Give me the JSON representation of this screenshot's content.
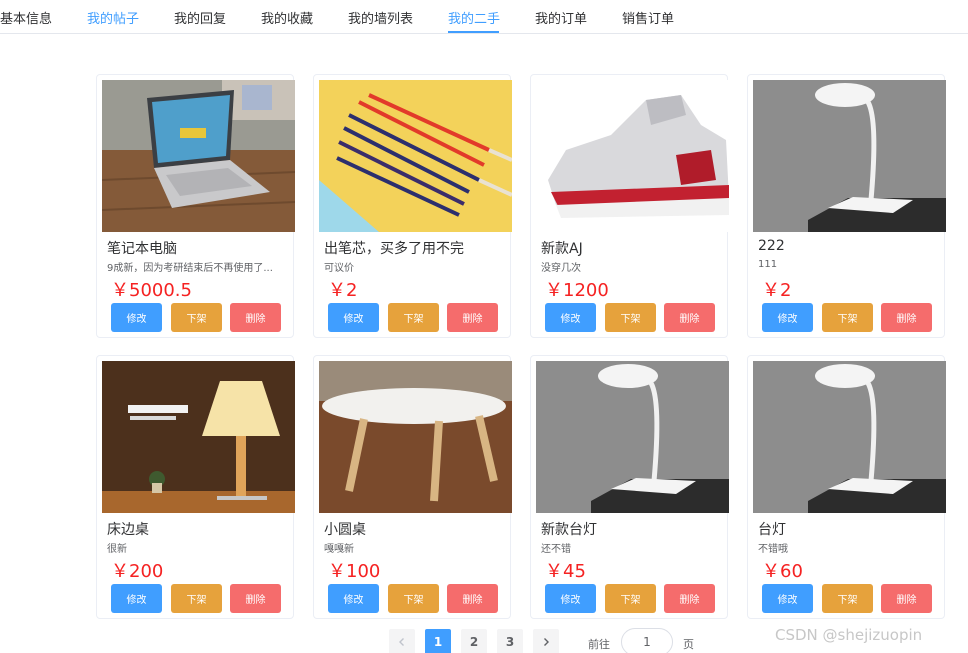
{
  "tabs": [
    {
      "label": "基本信息",
      "active": false
    },
    {
      "label": "我的帖子",
      "active": false
    },
    {
      "label": "我的回复",
      "active": false
    },
    {
      "label": "我的收藏",
      "active": false
    },
    {
      "label": "我的墙列表",
      "active": false
    },
    {
      "label": "我的二手",
      "active": true
    },
    {
      "label": "我的订单",
      "active": false
    },
    {
      "label": "销售订单",
      "active": false
    }
  ],
  "accent_color": "#409eff",
  "price_color": "#f52222",
  "button_labels": {
    "edit": "修改",
    "offline": "下架",
    "delete": "删除"
  },
  "products": [
    {
      "title": "笔记本电脑",
      "desc": "9成新，因为考研结束后不再使用了...",
      "price": "￥5000.5",
      "image": "laptop"
    },
    {
      "title": "出笔芯，买多了用不完",
      "desc": "可议价",
      "price": "￥2",
      "image": "pen-refills"
    },
    {
      "title": "新款AJ",
      "desc": "没穿几次",
      "price": "￥1200",
      "image": "sneaker"
    },
    {
      "title": "222",
      "desc": "111",
      "price": "￥2",
      "image": "desk-lamp"
    },
    {
      "title": "床边桌",
      "desc": "很新",
      "price": "￥200",
      "image": "table-lamp"
    },
    {
      "title": "小圆桌",
      "desc": "嘎嘎新",
      "price": "￥100",
      "image": "round-table"
    },
    {
      "title": "新款台灯",
      "desc": "还不错",
      "price": "￥45",
      "image": "desk-lamp"
    },
    {
      "title": "台灯",
      "desc": "不错哦",
      "price": "￥60",
      "image": "desk-lamp"
    }
  ],
  "pagination": {
    "prev_icon": "chevron-left-icon",
    "next_icon": "chevron-right-icon",
    "pages": [
      "1",
      "2",
      "3"
    ],
    "current": "1",
    "goto_label": "前往",
    "goto_value": "1",
    "page_unit": "页"
  },
  "watermark": "CSDN @shejizuopin"
}
